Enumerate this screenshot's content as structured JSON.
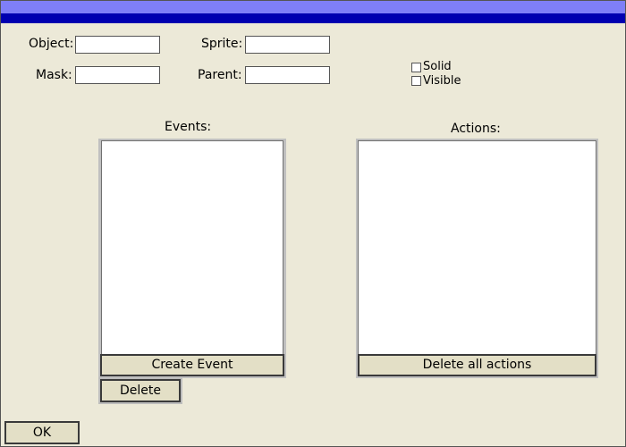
{
  "form": {
    "object_label": "Object:",
    "object_value": "",
    "sprite_label": "Sprite:",
    "sprite_value": "",
    "mask_label": "Mask:",
    "mask_value": "",
    "parent_label": "Parent:",
    "parent_value": "",
    "solid_label": "Solid",
    "solid_checked": false,
    "visible_label": "Visible",
    "visible_checked": false
  },
  "events": {
    "heading": "Events:",
    "items": [],
    "create_label": "Create Event",
    "delete_label": "Delete"
  },
  "actions": {
    "heading": "Actions:",
    "items": [],
    "delete_all_label": "Delete all actions"
  },
  "footer": {
    "ok_label": "OK"
  },
  "colors": {
    "title_bar": "#0000B0",
    "title_bar_highlight": "#7F7FF7",
    "window_bg": "#ECE9D8",
    "button_bg": "#E3DFC6"
  }
}
